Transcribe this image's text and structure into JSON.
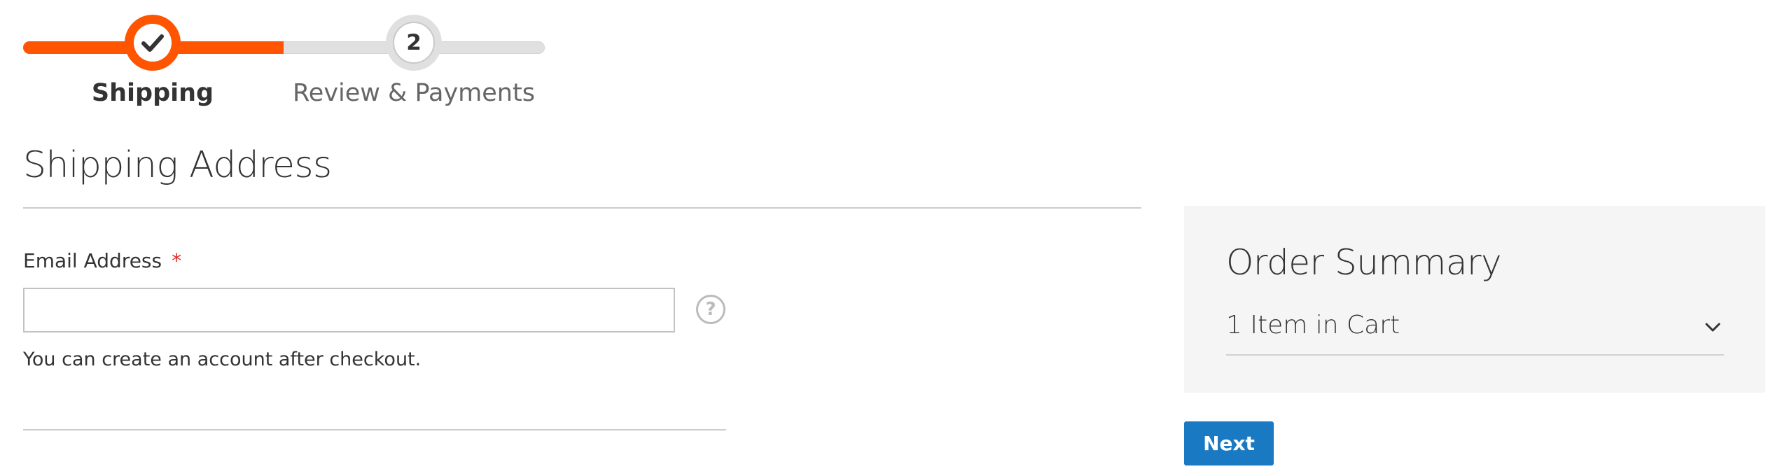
{
  "progress": {
    "steps": [
      {
        "number": "",
        "label": "Shipping",
        "state": "complete"
      },
      {
        "number": "2",
        "label": "Review & Payments",
        "state": "pending"
      }
    ],
    "colors": {
      "active": "#ff5501",
      "inactive": "#e0e0e0"
    },
    "icons": {
      "complete": "checkmark-icon"
    }
  },
  "shipping": {
    "title": "Shipping Address",
    "email": {
      "label": "Email Address",
      "required_marker": "*",
      "value": "",
      "placeholder": "",
      "help_icon": "question-icon",
      "help_glyph": "?",
      "note": "You can create an account after checkout."
    }
  },
  "summary": {
    "title": "Order Summary",
    "items_label": "1 Item in Cart",
    "toggle_icon": "chevron-down-icon"
  },
  "actions": {
    "next_label": "Next",
    "next_color": "#1979c3"
  },
  "colors": {
    "required": "#e02b27",
    "summary_background": "#f5f5f5"
  }
}
